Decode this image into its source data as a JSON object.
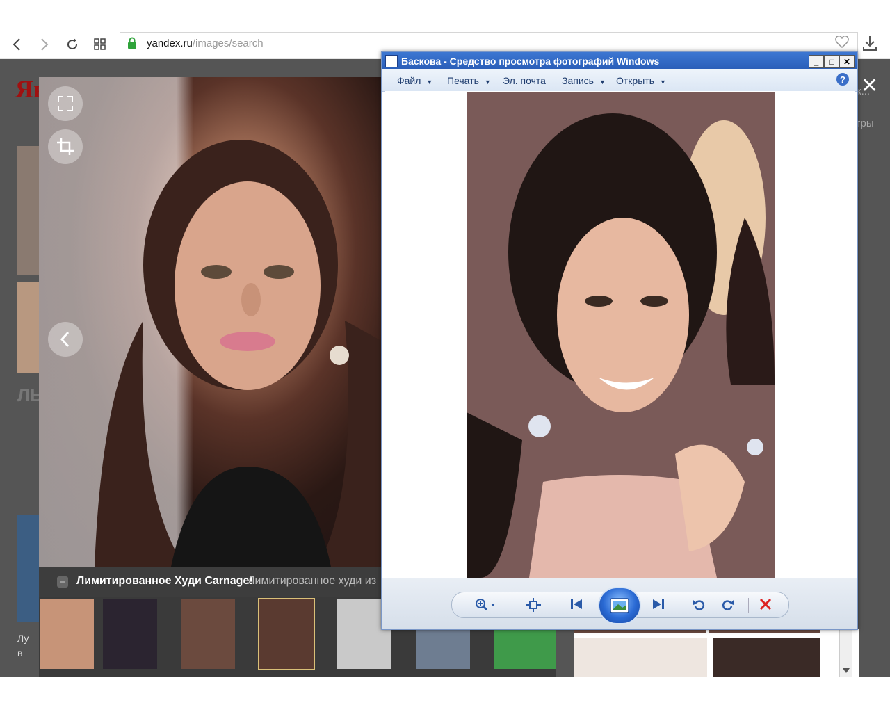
{
  "browser": {
    "url_host": "yandex.ru",
    "url_path": "/images/search"
  },
  "page": {
    "logo_text": "Ян",
    "snippet_left_1": "ЛЬ",
    "snippet_left_2": "Лу",
    "snippet_left_3": "в",
    "right_text_1": "к...",
    "right_text_2": "гры"
  },
  "viewer": {
    "caption_title": "Лимитированное Худи Carnage!",
    "caption_desc": "Лимитированное худи из"
  },
  "photo_viewer": {
    "title": "Баскова - Средство просмотра фотографий Windows",
    "menu": [
      {
        "label": "Файл",
        "has_arrow": true
      },
      {
        "label": "Печать",
        "has_arrow": true
      },
      {
        "label": "Эл. почта",
        "has_arrow": false
      },
      {
        "label": "Запись",
        "has_arrow": true
      },
      {
        "label": "Открыть",
        "has_arrow": true
      }
    ],
    "help_label": "?",
    "window_buttons": {
      "minimize": "_",
      "maximize": "□",
      "close": "✕"
    }
  },
  "thumbnails": [
    {
      "name": "thumb-1",
      "color": "#c79478",
      "selected": false
    },
    {
      "name": "thumb-2",
      "color": "#2b2430",
      "selected": false
    },
    {
      "name": "thumb-3",
      "color": "#6b4a3e",
      "selected": false
    },
    {
      "name": "thumb-4",
      "color": "#5a3a30",
      "selected": true
    },
    {
      "name": "thumb-5",
      "color": "#c9c9c9",
      "selected": false
    },
    {
      "name": "thumb-6",
      "color": "#6e7d91",
      "selected": false
    },
    {
      "name": "thumb-7",
      "color": "#3f9a4a",
      "selected": false
    }
  ],
  "colors": {
    "accent_blue": "#2b5fb9",
    "lock_green": "#2fa33a",
    "overlay_gray": "#555555"
  }
}
